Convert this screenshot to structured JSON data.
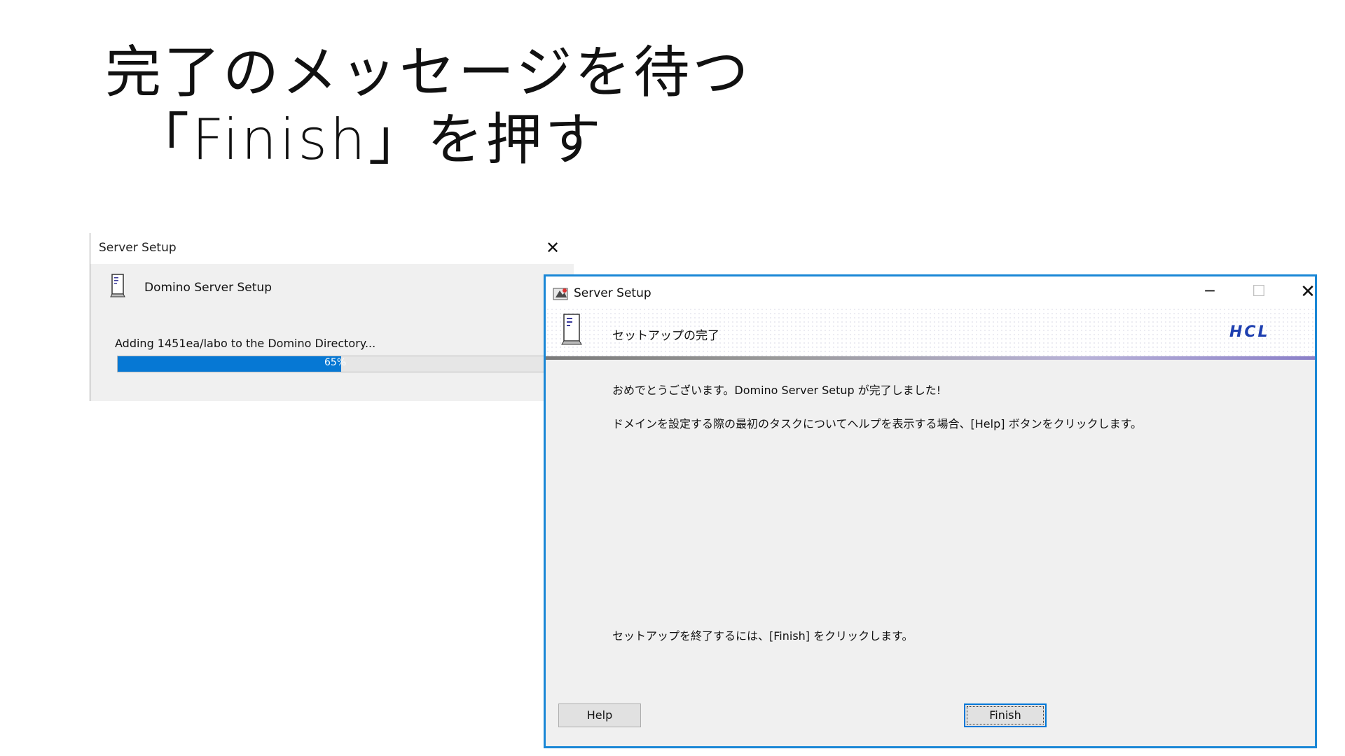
{
  "slide": {
    "heading_line1": "完了のメッセージを待つ",
    "heading_line2": "「Finish」を押す"
  },
  "progress_window": {
    "title": "Server Setup",
    "close_glyph": "✕",
    "header": "Domino Server Setup",
    "status": "Adding 1451ea/labo to the Domino Directory...",
    "progress_percent_label": "65%",
    "progress_fraction": 0.49,
    "progress_color": "#0678d4",
    "icon": "server-document-icon"
  },
  "dialog": {
    "title": "Server Setup",
    "app_icon": "setup-app-icon",
    "min_glyph": "─",
    "max_glyph": "☐",
    "close_glyph": "✕",
    "banner_title": "セットアップの完了",
    "banner_icon": "server-document-icon",
    "logo_text": "HCL",
    "message_1": "おめでとうございます。Domino Server Setup が完了しました!",
    "message_2": "ドメインを設定する際の最初のタスクについてヘルプを表示する場合、[Help] ボタンをクリックします。",
    "message_3": "セットアップを終了するには、[Finish] をクリックします。",
    "help_button": "Help",
    "finish_button": "Finish",
    "accent_color": "#1a87d6"
  }
}
